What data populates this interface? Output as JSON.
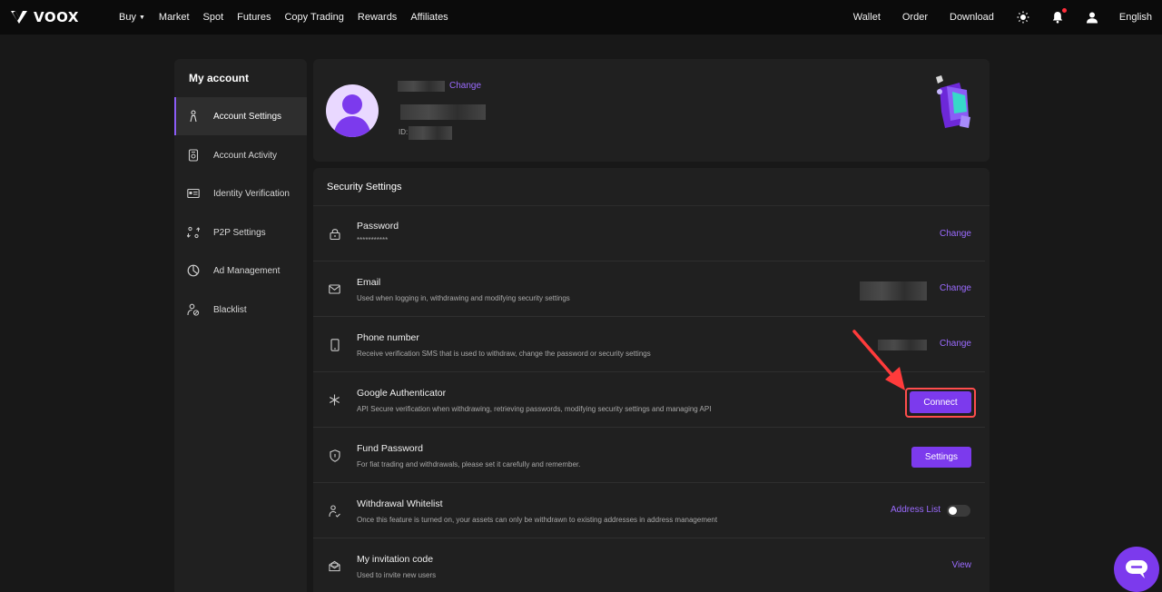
{
  "brand": {
    "name": "VOOX"
  },
  "nav": {
    "left": [
      "Buy",
      "Market",
      "Spot",
      "Futures",
      "Copy Trading",
      "Rewards",
      "Affiliates"
    ],
    "right": {
      "wallet": "Wallet",
      "order": "Order",
      "download": "Download",
      "language": "English"
    }
  },
  "sidebar": {
    "title": "My account",
    "items": [
      {
        "label": "Account Settings",
        "icon": "person-icon",
        "active": true
      },
      {
        "label": "Account Activity",
        "icon": "activity-icon",
        "active": false
      },
      {
        "label": "Identity Verification",
        "icon": "id-card-icon",
        "active": false
      },
      {
        "label": "P2P Settings",
        "icon": "p2p-icon",
        "active": false
      },
      {
        "label": "Ad Management",
        "icon": "pie-chart-icon",
        "active": false
      },
      {
        "label": "Blacklist",
        "icon": "user-block-icon",
        "active": false
      }
    ]
  },
  "profile": {
    "change_label": "Change",
    "id_label": "ID:"
  },
  "security": {
    "title": "Security Settings",
    "rows": [
      {
        "title": "Password",
        "desc": "***********",
        "action": "Change",
        "icon": "lock-icon"
      },
      {
        "title": "Email",
        "desc": "Used when logging in, withdrawing and modifying security settings",
        "action": "Change",
        "icon": "mail-icon"
      },
      {
        "title": "Phone number",
        "desc": "Receive verification SMS that is used to withdraw, change the password or security settings",
        "action": "Change",
        "icon": "phone-icon"
      },
      {
        "title": "Google Authenticator",
        "desc": "API Secure verification when withdrawing, retrieving passwords, modifying security settings and managing API",
        "action": "Connect",
        "icon": "asterisk-icon"
      },
      {
        "title": "Fund Password",
        "desc": "For fiat trading and withdrawals, please set it carefully and remember.",
        "action": "Settings",
        "icon": "shield-icon"
      },
      {
        "title": "Withdrawal Whitelist",
        "desc": "Once this feature is turned on, your assets can only be withdrawn to existing addresses in address management",
        "action": "Address List",
        "icon": "whitelist-icon",
        "toggle_on": false
      },
      {
        "title": "My invitation code",
        "desc": "Used to invite new users",
        "action": "View",
        "icon": "invite-icon"
      }
    ]
  },
  "colors": {
    "accent": "#7c3aed",
    "link": "#9b6bff",
    "highlight": "#ff4d4d"
  }
}
